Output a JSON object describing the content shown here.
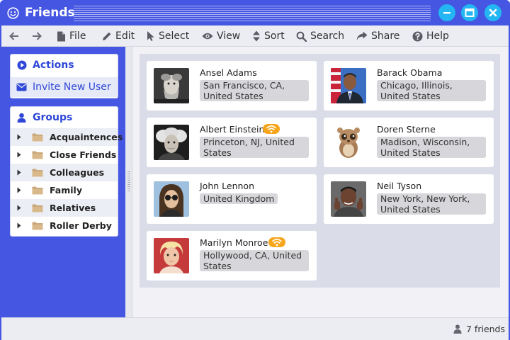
{
  "window": {
    "title": "Friends",
    "accent_color": "#4556e3",
    "control_button_color": "#23b6f2",
    "icons": [
      "smiley-icon",
      "minimize-icon",
      "maximize-icon",
      "close-icon"
    ]
  },
  "menubar": {
    "back_icon": "arrow-left-icon",
    "forward_icon": "arrow-right-icon",
    "items": [
      {
        "label": "File",
        "icon": "file-icon"
      },
      {
        "label": "Edit",
        "icon": "pencil-icon"
      },
      {
        "label": "Select",
        "icon": "cursor-icon"
      },
      {
        "label": "View",
        "icon": "eye-icon"
      },
      {
        "label": "Sort",
        "icon": "sort-icon"
      },
      {
        "label": "Search",
        "icon": "search-icon"
      },
      {
        "label": "Share",
        "icon": "share-icon"
      },
      {
        "label": "Help",
        "icon": "help-icon"
      }
    ]
  },
  "sidebar": {
    "actions": {
      "header": "Actions",
      "header_icon": "play-circle-icon",
      "invite_label": "Invite New User",
      "invite_icon": "envelope-icon"
    },
    "groups": {
      "header": "Groups",
      "header_icon": "user-icon",
      "items": [
        {
          "label": "Acquaintences"
        },
        {
          "label": "Close Friends"
        },
        {
          "label": "Colleagues"
        },
        {
          "label": "Family"
        },
        {
          "label": "Relatives"
        },
        {
          "label": "Roller Derby"
        }
      ]
    }
  },
  "friends": [
    {
      "name": "Ansel Adams",
      "location": "San Francisco, CA, United States",
      "online": false
    },
    {
      "name": "Barack Obama",
      "location": "Chicago, Illinois, United States",
      "online": false
    },
    {
      "name": "Albert Einstein",
      "location": "Princeton, NJ, United States",
      "online": true
    },
    {
      "name": "Doren Sterne",
      "location": "Madison, Wisconsin, United States",
      "online": false
    },
    {
      "name": "John Lennon",
      "location": "United Kingdom",
      "online": false
    },
    {
      "name": "Neil Tyson",
      "location": "New York, New York, United States",
      "online": false
    },
    {
      "name": "Marilyn Monroe",
      "location": "Hollywood, CA, United States",
      "online": true
    }
  ],
  "status": {
    "count_label": "7 friends",
    "icon": "person-icon"
  }
}
